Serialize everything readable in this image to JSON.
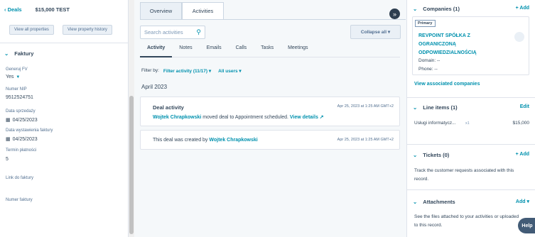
{
  "left": {
    "back_label": "Deals",
    "deal_title": "$15,000 TEST",
    "view_all_properties": "View all properties",
    "view_property_history": "View property history",
    "section_title": "Faktury",
    "fields": [
      {
        "label": "Generuj FV",
        "value": "Yes"
      },
      {
        "label": "Numer NIP",
        "value": "9512524751"
      },
      {
        "label": "Data sprzedaży",
        "value": "04/25/2023"
      },
      {
        "label": "Data wystawienia faktury",
        "value": "04/25/2023"
      },
      {
        "label": "Termin płatności",
        "value": "5"
      },
      {
        "label": "Link do faktury",
        "value": ""
      },
      {
        "label": "Numer faktury",
        "value": ""
      }
    ]
  },
  "middle": {
    "tabs": [
      "Overview",
      "Activities"
    ],
    "search_placeholder": "Search activities",
    "collapse_all": "Collapse all",
    "subtabs": [
      "Activity",
      "Notes",
      "Emails",
      "Calls",
      "Tasks",
      "Meetings"
    ],
    "filter_by": "Filter by:",
    "filter_activity": "Filter activity (11/17)",
    "all_users": "All users",
    "month": "April 2023",
    "card1": {
      "title": "Deal activity",
      "time": "Apr 25, 2023 at 1:25 AM GMT+2",
      "actor": "Wojtek Chrapkowski",
      "text": "moved deal to Appointment scheduled.",
      "link": "View details"
    },
    "card2": {
      "prefix": "This deal was created by",
      "actor": "Wojtek Chrapkowski",
      "time": "Apr 25, 2023 at 1:25 AM GMT+2"
    }
  },
  "right": {
    "companies_title": "Companies (1)",
    "add": "+ Add",
    "primary_badge": "Primary",
    "company_name_lines": [
      "REVPOINT SPÓŁKA Z",
      "OGRANICZONĄ",
      "ODPOWIEDZIALNOŚCIĄ"
    ],
    "domain": "Domain: --",
    "phone": "Phone: --",
    "view_associated": "View associated companies",
    "line_items_title": "Line items (1)",
    "edit": "Edit",
    "line_item_name": "Usługi informatycz...",
    "line_item_qty": "x1",
    "line_item_price": "$15,000",
    "tickets_title": "Tickets (0)",
    "tickets_text": "Track the customer requests associated with this record.",
    "attachments_title": "Attachments",
    "attachments_add": "Add",
    "attachments_text": "See the files attached to your activities or uploaded to this record.",
    "help": "Help"
  }
}
